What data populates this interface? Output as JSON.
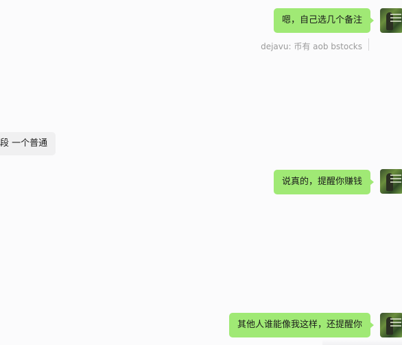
{
  "messages": [
    {
      "id": "m1",
      "direction": "out",
      "text": "嗯，自己选几个备注"
    },
    {
      "id": "m2",
      "direction": "in",
      "text": "段 一个普通"
    },
    {
      "id": "m3",
      "direction": "out",
      "text": "说真的，提醒你赚钱"
    },
    {
      "id": "m4",
      "direction": "out",
      "text": "其他人谁能像我这样，还提醒你"
    }
  ],
  "quote": {
    "text": "dejavu: 币有 aob bstocks"
  },
  "colors": {
    "outgoing_bubble": "#a0e975",
    "incoming_bubble": "#f0f0f1",
    "background": "#fbfbfc",
    "quote_text": "#9a9a9a"
  },
  "icons": {
    "self_avatar": "user-avatar-photo"
  }
}
